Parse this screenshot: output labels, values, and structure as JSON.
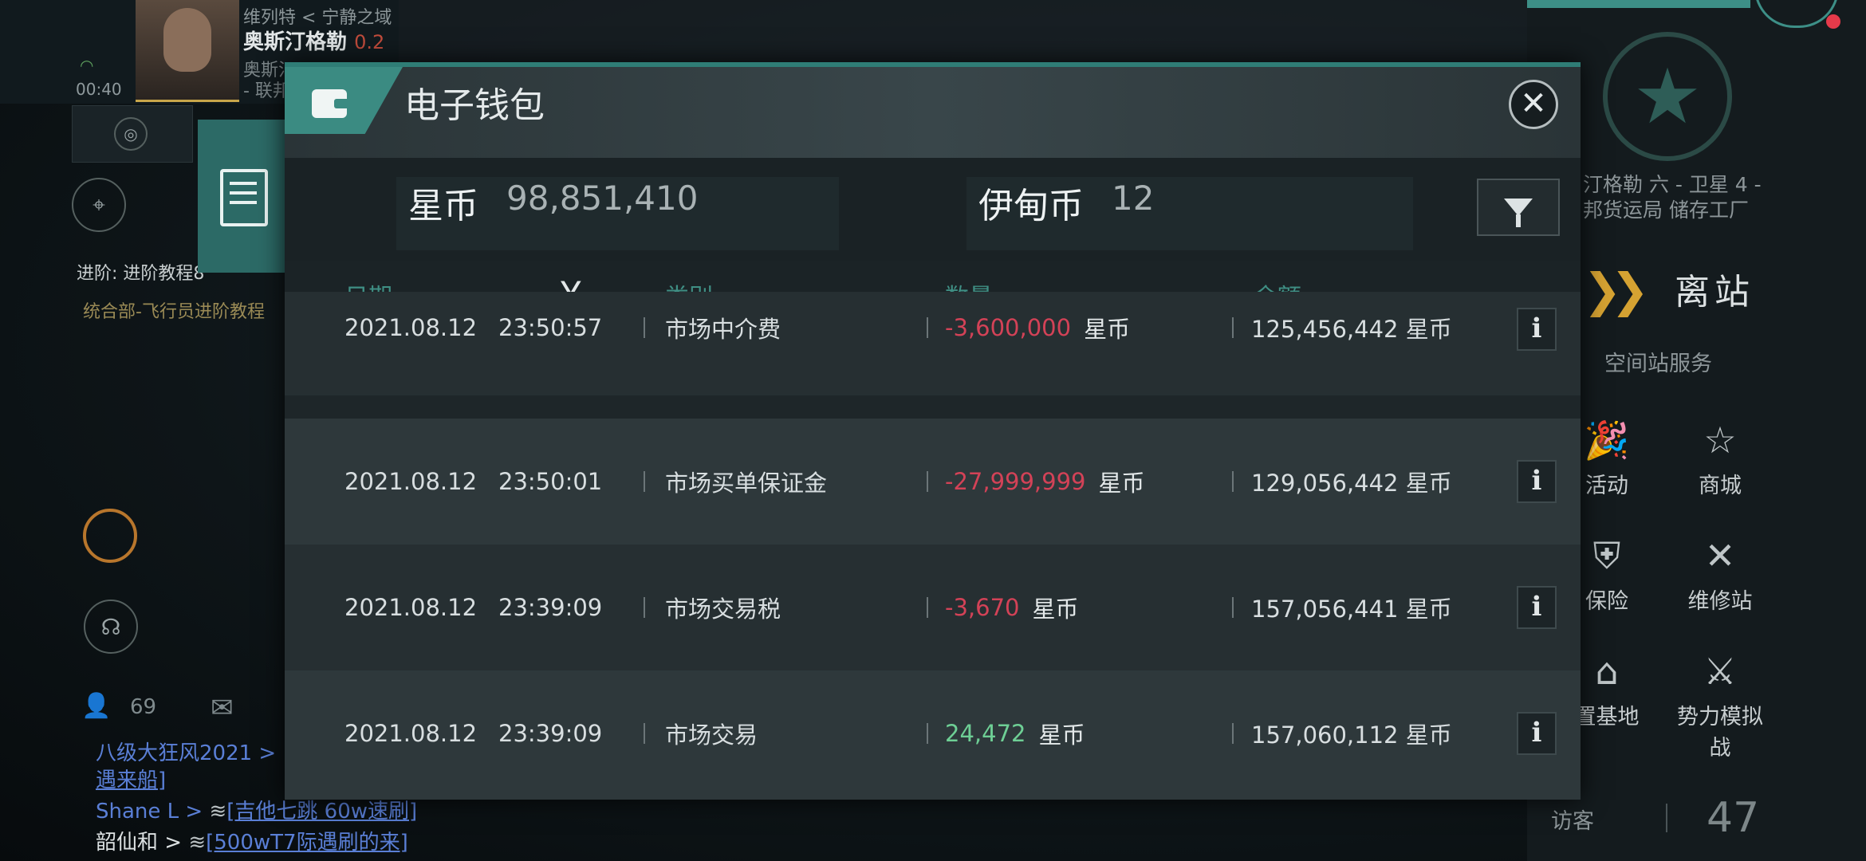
{
  "background_hud": {
    "pilot": {
      "region": "维列特  < 宁静之域",
      "name": "奥斯汀格勒",
      "security": "0.2",
      "sub_line1": "奥斯汀",
      "sub_line2": "- 联邦",
      "clock": "00:40"
    },
    "quest": {
      "line1": "进阶: 进阶教程8",
      "line2": "统合部-飞行员进阶教程"
    },
    "chat": {
      "online_count": "69",
      "lines": [
        {
          "name": "八级大狂风2021 >",
          "link": ""
        },
        {
          "name": "",
          "link": "遇来船]"
        },
        {
          "name": "Shane L >",
          "link": "[吉他七跳 60w速刷]"
        },
        {
          "name": "韶仙和 >",
          "link": "[500wT7际遇刷的来]"
        }
      ]
    },
    "station": {
      "loc_line1": "汀格勒 六 - 卫星 4 -",
      "loc_line2": "邦货运局 储存工厂",
      "undock_label": "离站",
      "services_title": "空间站服务",
      "services": [
        {
          "label": "活动",
          "icon": "party-popper-icon"
        },
        {
          "label": "商城",
          "icon": "store-star-icon"
        },
        {
          "label": "保险",
          "icon": "insurance-shield-icon"
        },
        {
          "label": "维修站",
          "icon": "repair-tools-icon"
        },
        {
          "label": "置基地",
          "icon": "base-icon"
        },
        {
          "label": "势力模拟战",
          "icon": "crossed-flags-icon"
        }
      ],
      "visitor_label": "访客",
      "visitor_count": "47"
    }
  },
  "wallet": {
    "title": "电子钱包",
    "balances": [
      {
        "label": "星币",
        "value": "98,851,410"
      },
      {
        "label": "伊甸币",
        "value": "12"
      }
    ],
    "columns": {
      "date": "日期",
      "category": "类别",
      "amount": "数量",
      "balance": "余额"
    },
    "rows": [
      {
        "date": "2021.08.12",
        "time": "23:50:57",
        "category": "市场中介费",
        "amount": "-3,600,000",
        "amount_unit": "星币",
        "sign": "neg",
        "balance": "125,456,442 星币"
      },
      {
        "date": "2021.08.12",
        "time": "23:50:01",
        "category": "市场买单保证金",
        "amount": "-27,999,999",
        "amount_unit": "星币",
        "sign": "neg",
        "balance": "129,056,442 星币"
      },
      {
        "date": "2021.08.12",
        "time": "23:39:09",
        "category": "市场交易税",
        "amount": "-3,670",
        "amount_unit": "星币",
        "sign": "neg",
        "balance": "157,056,441 星币"
      },
      {
        "date": "2021.08.12",
        "time": "23:39:09",
        "category": "市场交易",
        "amount": "24,472",
        "amount_unit": "星币",
        "sign": "pos",
        "balance": "157,060,112 星币"
      }
    ],
    "info_glyph": "i",
    "close_glyph": "✕"
  },
  "colors": {
    "accent": "#3b8b82",
    "negative": "#d34257",
    "positive": "#6ecf95",
    "header_text": "#3f8f84"
  }
}
